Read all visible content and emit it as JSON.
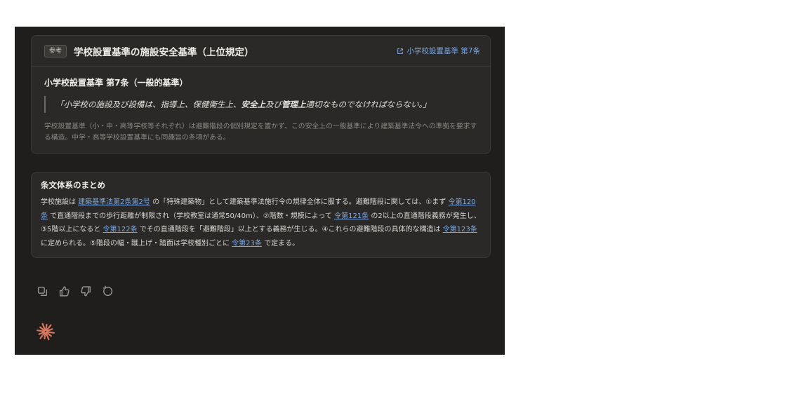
{
  "reference": {
    "badge": "参考",
    "title": "学校設置基準の施設安全基準（上位規定）",
    "link_label": "小学校設置基準 第7条",
    "article_title": "小学校設置基準 第7条（一般的基準）",
    "quote": {
      "p1": "「小学校の施設及び設備は、指導上、保健衛生上、",
      "em1": "安全上",
      "p2": "及び",
      "em2": "管理上",
      "p3": "適切なものでなければならない。」"
    },
    "note": "学校設置基準（小・中・高等学校等それぞれ）は避難階段の個別規定を置かず、この安全上の一般基準により建築基準法令への準拠を要求する構造。中学・高等学校設置基準にも同趣旨の条項がある。"
  },
  "summary": {
    "title": "条文体系のまとめ",
    "t1": "学校施設は ",
    "l1": "建築基準法第2条第2号",
    "t2": " の「特殊建築物」として建築基準法施行令の規律全体に服する。避難階段に関しては、①まず ",
    "l2": "令第120条",
    "t3": " で直通階段までの歩行距離が制限され（学校教室は通常50/40m）、②階数・規模によって ",
    "l3": "令第121条",
    "t4": " の2以上の直通階段義務が発生し、③5階以上になると ",
    "l4": "令第122条",
    "t5": " でその直通階段を「避難階段」以上とする義務が生じる。④これらの避難階段の具体的な構造は ",
    "l5": "令第123条",
    "t6": " に定められる。⑤階段の幅・蹴上げ・踏面は学校種別ごとに ",
    "l6": "令第23条",
    "t7": " で定まる。"
  },
  "actions": {
    "icons": [
      "copy-icon",
      "thumbs-up-icon",
      "thumbs-down-icon",
      "retry-icon"
    ]
  },
  "colors": {
    "accent_link": "#7fa8e0",
    "logo": "#d9775c",
    "panel_bg": "#1f1e1d",
    "card_bg": "#2a2928"
  }
}
